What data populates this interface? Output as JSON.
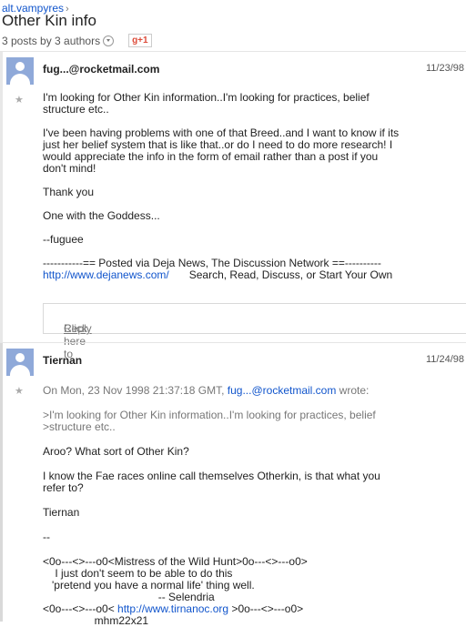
{
  "header": {
    "breadcrumb": "alt.vampyres",
    "breadcrumb_sep": "›",
    "title": "Other Kin info",
    "meta": "3 posts by 3 authors",
    "gplus": "g+1"
  },
  "posts": [
    {
      "author": "fug...@rocketmail.com",
      "date": "11/23/98",
      "lines": {
        "l1": "I'm looking for Other Kin information..I'm looking for practices, belief",
        "l2": "structure etc..",
        "l3": "I've been having problems with one of that Breed..and I want to know if its",
        "l4": "just her belief system that is like that..or do I need to do more research! I",
        "l5": "would appreciate the info in the form of email rather than a post if you",
        "l6": "don't mind!",
        "l7": "Thank you",
        "l8": "One with the Goddess...",
        "l9": "--fuguee",
        "l10": "-----------== Posted via Deja News, The Discussion Network ==----------",
        "link": "http://www.dejanews.com/",
        "l11_tail": "Search, Read, Discuss, or Start Your Own"
      },
      "reply": {
        "prefix": "Click here to ",
        "link": "Reply"
      }
    },
    {
      "author": "Tiernan",
      "date": "11/24/98",
      "wrote_prefix": "On Mon, 23 Nov 1998 21:37:18 GMT, ",
      "wrote_email": "fug...@rocketmail.com",
      "wrote_suffix": " wrote:",
      "lines": {
        "q1": ">I'm looking for Other Kin information..I'm looking for practices, belief",
        "q2": ">structure etc..",
        "l1": "Aroo?  What sort of Other Kin?",
        "l2": "I know the Fae races online call themselves Otherkin, is that what you",
        "l3": "refer to?",
        "l4": "Tiernan",
        "l5": "--",
        "s1": "<0o---<>---o0<Mistress of the Wild Hunt>0o---<>---o0>",
        "s2": "    I just don't seem to be able to do this",
        "s3": "   'pretend you have a normal life' thing well.",
        "s4": "                                      -- Selendria",
        "s5_pre": "<0o---<>---o0< ",
        "s5_link": "http://www.tirnanoc.org",
        "s5_post": " >0o---<>---o0>",
        "s6": "                 mhm22x21"
      }
    }
  ]
}
